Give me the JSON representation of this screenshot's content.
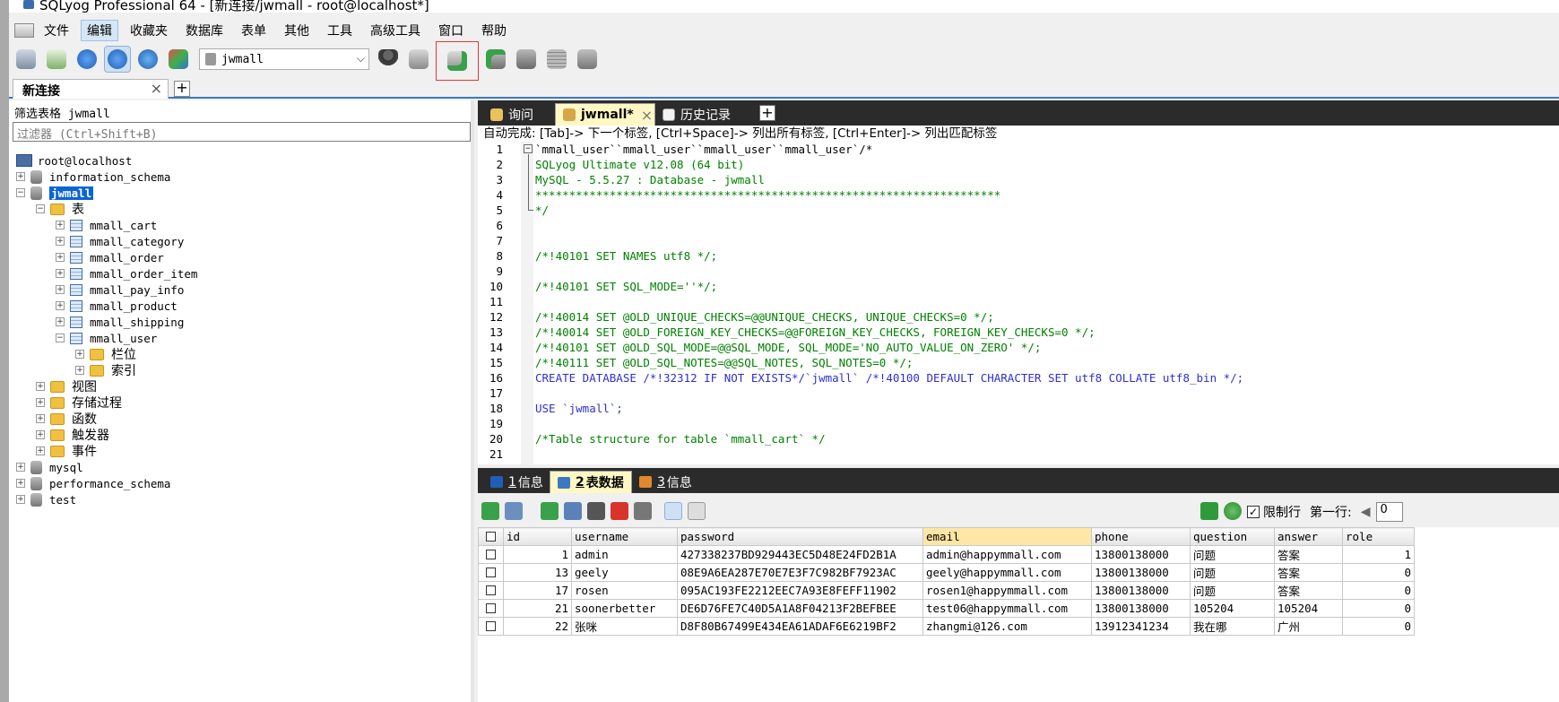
{
  "window": {
    "title": "SQLyog Professional 64 - [新连接/jwmall - root@localhost*]"
  },
  "menu": [
    "文件",
    "编辑",
    "收藏夹",
    "数据库",
    "表单",
    "其他",
    "工具",
    "高级工具",
    "窗口",
    "帮助"
  ],
  "toolbar": {
    "db_select": "jwmall"
  },
  "conn_tab": {
    "label": "新连接",
    "close": "×",
    "add": "+"
  },
  "left": {
    "filter_label": "筛选表格 jwmall",
    "filter_placeholder": "过滤器 (Ctrl+Shift+B)",
    "tree": [
      {
        "label": "root@localhost",
        "level": 0,
        "kind": "server"
      },
      {
        "label": "information_schema",
        "level": 0,
        "kind": "db",
        "exp": "+"
      },
      {
        "label": "jwmall",
        "level": 0,
        "kind": "db",
        "exp": "−",
        "selected": true
      },
      {
        "label": "表",
        "level": 1,
        "kind": "folder",
        "exp": "−"
      },
      {
        "label": "mmall_cart",
        "level": 2,
        "kind": "table",
        "exp": "+"
      },
      {
        "label": "mmall_category",
        "level": 2,
        "kind": "table",
        "exp": "+"
      },
      {
        "label": "mmall_order",
        "level": 2,
        "kind": "table",
        "exp": "+"
      },
      {
        "label": "mmall_order_item",
        "level": 2,
        "kind": "table",
        "exp": "+"
      },
      {
        "label": "mmall_pay_info",
        "level": 2,
        "kind": "table",
        "exp": "+"
      },
      {
        "label": "mmall_product",
        "level": 2,
        "kind": "table",
        "exp": "+"
      },
      {
        "label": "mmall_shipping",
        "level": 2,
        "kind": "table",
        "exp": "+"
      },
      {
        "label": "mmall_user",
        "level": 2,
        "kind": "table",
        "exp": "−"
      },
      {
        "label": "栏位",
        "level": 3,
        "kind": "folder",
        "exp": "+"
      },
      {
        "label": "索引",
        "level": 3,
        "kind": "folder",
        "exp": "+"
      },
      {
        "label": "视图",
        "level": 1,
        "kind": "folder",
        "exp": "+"
      },
      {
        "label": "存储过程",
        "level": 1,
        "kind": "folder",
        "exp": "+"
      },
      {
        "label": "函数",
        "level": 1,
        "kind": "folder",
        "exp": "+"
      },
      {
        "label": "触发器",
        "level": 1,
        "kind": "folder",
        "exp": "+"
      },
      {
        "label": "事件",
        "level": 1,
        "kind": "folder",
        "exp": "+"
      },
      {
        "label": "mysql",
        "level": 0,
        "kind": "db",
        "exp": "+"
      },
      {
        "label": "performance_schema",
        "level": 0,
        "kind": "db",
        "exp": "+"
      },
      {
        "label": "test",
        "level": 0,
        "kind": "db",
        "exp": "+"
      }
    ]
  },
  "query_tabs": {
    "query": "询问",
    "active": "jwmall*",
    "history": "历史记录",
    "close": "×",
    "add": "+"
  },
  "hint": "自动完成: [Tab]-> 下一个标签, [Ctrl+Space]-> 列出所有标签, [Ctrl+Enter]-> 列出匹配标签",
  "editor": {
    "lines": [
      {
        "n": "1",
        "t": "`mmall_user``mmall_user``mmall_user``mmall_user`/*",
        "c": ""
      },
      {
        "n": "2",
        "t": "SQLyog Ultimate v12.08 (64 bit)",
        "c": "c-com"
      },
      {
        "n": "3",
        "t": "MySQL - 5.5.27 : Database - jwmall",
        "c": "c-com"
      },
      {
        "n": "4",
        "t": "*********************************************************************",
        "c": "c-com"
      },
      {
        "n": "5",
        "t": "*/",
        "c": "c-com"
      },
      {
        "n": "6",
        "t": "",
        "c": ""
      },
      {
        "n": "7",
        "t": "",
        "c": ""
      },
      {
        "n": "8",
        "t": "/*!40101 SET NAMES utf8 */;",
        "c": "c-com"
      },
      {
        "n": "9",
        "t": "",
        "c": ""
      },
      {
        "n": "10",
        "t": "/*!40101 SET SQL_MODE=''*/;",
        "c": "c-com"
      },
      {
        "n": "11",
        "t": "",
        "c": ""
      },
      {
        "n": "12",
        "t": "/*!40014 SET @OLD_UNIQUE_CHECKS=@@UNIQUE_CHECKS, UNIQUE_CHECKS=0 */;",
        "c": "c-com"
      },
      {
        "n": "13",
        "t": "/*!40014 SET @OLD_FOREIGN_KEY_CHECKS=@@FOREIGN_KEY_CHECKS, FOREIGN_KEY_CHECKS=0 */;",
        "c": "c-com"
      },
      {
        "n": "14",
        "t": "/*!40101 SET @OLD_SQL_MODE=@@SQL_MODE, SQL_MODE='NO_AUTO_VALUE_ON_ZERO' */;",
        "c": "c-com"
      },
      {
        "n": "15",
        "t": "/*!40111 SET @OLD_SQL_NOTES=@@SQL_NOTES, SQL_NOTES=0 */;",
        "c": "c-com"
      },
      {
        "n": "16",
        "t": "CREATE DATABASE /*!32312 IF NOT EXISTS*/`jwmall` /*!40100 DEFAULT CHARACTER SET utf8 COLLATE utf8_bin */;",
        "c": "mixed16"
      },
      {
        "n": "17",
        "t": "",
        "c": ""
      },
      {
        "n": "18",
        "t": "USE `jwmall`;",
        "c": "mixed18"
      },
      {
        "n": "19",
        "t": "",
        "c": ""
      },
      {
        "n": "20",
        "t": "/*Table structure for table `mmall_cart` */",
        "c": "c-com"
      },
      {
        "n": "21",
        "t": "",
        "c": ""
      }
    ]
  },
  "result_tabs": [
    {
      "num": "1",
      "label": "信息"
    },
    {
      "num": "2",
      "label": "表数据"
    },
    {
      "num": "3",
      "label": "信息"
    }
  ],
  "grid_toolbar": {
    "limit_label": "限制行",
    "first_row_label": "第一行:",
    "first_row_value": "0",
    "limit_checked": "✓"
  },
  "grid": {
    "columns": [
      "id",
      "username",
      "password",
      "email",
      "phone",
      "question",
      "answer",
      "role"
    ],
    "rows": [
      [
        "1",
        "admin",
        "427338237BD929443EC5D48E24FD2B1A",
        "admin@happymmall.com",
        "13800138000",
        "问题",
        "答案",
        "1"
      ],
      [
        "13",
        "geely",
        "08E9A6EA287E70E7E3F7C982BF7923AC",
        "geely@happymmall.com",
        "13800138000",
        "问题",
        "答案",
        "0"
      ],
      [
        "17",
        "rosen",
        "095AC193FE2212EEC7A93E8FEFF11902",
        "rosen1@happymmall.com",
        "13800138000",
        "问题",
        "答案",
        "0"
      ],
      [
        "21",
        "soonerbetter",
        "DE6D76FE7C40D5A1A8F04213F2BEFBEE",
        "test06@happymmall.com",
        "13800138000",
        "105204",
        "105204",
        "0"
      ],
      [
        "22",
        "张咪",
        "D8F80B67499E434EA61ADAF6E6219BF2",
        "zhangmi@126.com",
        "13912341234",
        "我在哪",
        "广州",
        "0"
      ]
    ]
  },
  "colors": {
    "accent": "#0a64d6",
    "tabbar": "#2b2b2b",
    "active_tab": "#fff8c4",
    "comment": "#008000",
    "keyword": "#0000ff"
  }
}
